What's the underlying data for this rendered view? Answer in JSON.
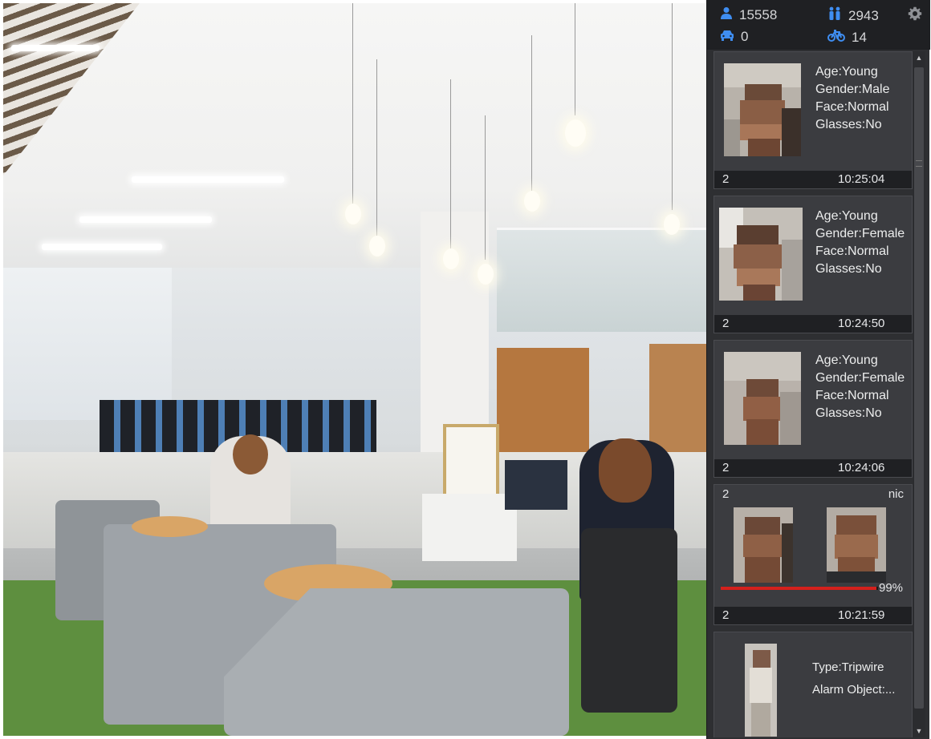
{
  "stats": {
    "people_icon": "person-icon",
    "people_count": "15558",
    "nonmotor_icon": "pedestrian-pair-icon",
    "nonmotor_count": "2943",
    "vehicle_icon": "car-icon",
    "vehicle_count": "0",
    "bike_icon": "bicycle-icon",
    "bike_count": "14",
    "settings_icon": "gear-icon",
    "accent_color": "#3f8ef2"
  },
  "events": [
    {
      "type": "face-attributes",
      "attributes": [
        "Age:Young",
        "Gender:Male",
        "Face:Normal",
        "Glasses:No"
      ],
      "channel": "2",
      "time": "10:25:04"
    },
    {
      "type": "face-attributes",
      "attributes": [
        "Age:Young",
        "Gender:Female",
        "Face:Normal",
        "Glasses:No"
      ],
      "channel": "2",
      "time": "10:24:50"
    },
    {
      "type": "face-attributes",
      "attributes": [
        "Age:Young",
        "Gender:Female",
        "Face:Normal",
        "Glasses:No"
      ],
      "channel": "2",
      "time": "10:24:06"
    },
    {
      "type": "face-comparison",
      "channel": "2",
      "name": "nic",
      "similarity": "99%",
      "similarity_value": 99,
      "time": "10:21:59",
      "bar_color": "#d4201c"
    },
    {
      "type": "tripwire",
      "attributes": [
        "Type:Tripwire",
        "Alarm Object:..."
      ]
    }
  ],
  "scrollbar": {
    "up_icon": "scroll-up-arrow-icon",
    "down_icon": "scroll-down-arrow-icon"
  }
}
